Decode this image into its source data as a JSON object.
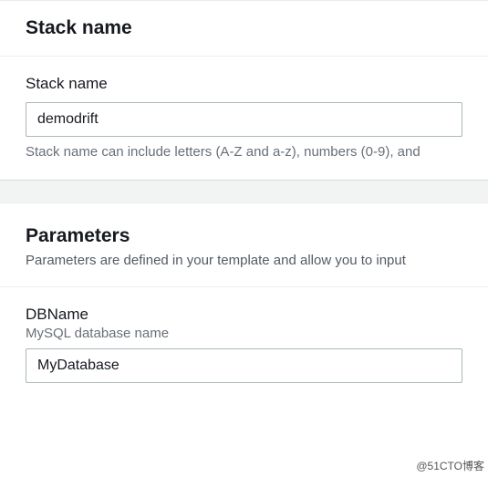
{
  "stack": {
    "heading": "Stack name",
    "field_label": "Stack name",
    "value": "demodrift",
    "hint": "Stack name can include letters (A-Z and a-z), numbers (0-9), and"
  },
  "parameters": {
    "heading": "Parameters",
    "description": "Parameters are defined in your template and allow you to input",
    "db": {
      "label": "DBName",
      "sub_label": "MySQL database name",
      "value": "MyDatabase"
    }
  },
  "watermark": "@51CTO博客"
}
